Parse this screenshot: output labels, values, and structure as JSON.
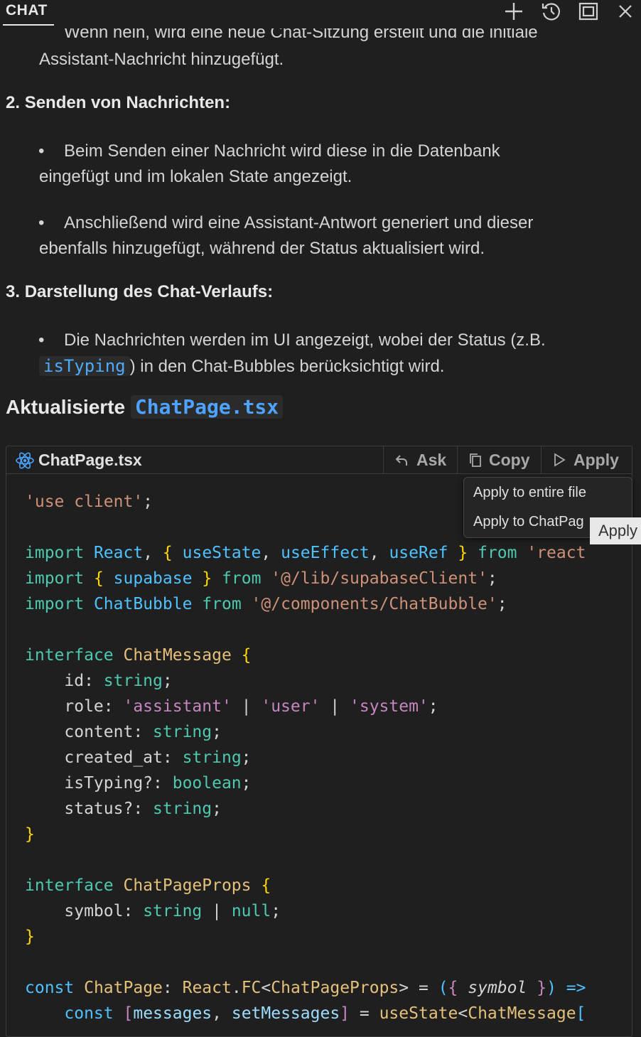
{
  "header": {
    "tab_label": "CHAT",
    "icons": [
      "plus-icon",
      "history-icon",
      "maximize-icon",
      "close-icon"
    ]
  },
  "message": {
    "cut_line": "Wenn nein, wird eine neue Chat-Sitzung erstellt und die initiale",
    "line0": "Assistant-Nachricht hinzugefügt.",
    "section2_num": "2.",
    "section2_title": "Senden von Nachrichten:",
    "s2_b1_l1": "Beim Senden einer Nachricht wird diese in die Datenbank",
    "s2_b1_l2": "eingefügt und im lokalen State angezeigt.",
    "s2_b2_l1": "Anschließend wird eine Assistant-Antwort generiert und dieser",
    "s2_b2_l2": "ebenfalls hinzugefügt, während der Status aktualisiert wird.",
    "section3_num": "3.",
    "section3_title": "Darstellung des Chat-Verlaufs:",
    "s3_b1_l1": "Die Nachrichten werden im UI angezeigt, wobei der Status (z.B.",
    "s3_b1_code": "isTyping",
    "s3_b1_l2": ") in den Chat-Bubbles berücksichtigt wird.",
    "h2_text": "Aktualisierte",
    "h2_code": "ChatPage.tsx"
  },
  "codeblock": {
    "filename": "ChatPage.tsx",
    "ask_label": "Ask",
    "copy_label": "Copy",
    "apply_label": "Apply",
    "code": {
      "l1": [
        "'use client'",
        ";"
      ],
      "l3": [
        "import",
        "React",
        "useState",
        "useEffect",
        "useRef",
        "from",
        "'react"
      ],
      "l4": [
        "import",
        "supabase",
        "from",
        "'@/lib/supabaseClient'",
        ";"
      ],
      "l5": [
        "import",
        "ChatBubble",
        "from",
        "'@/components/ChatBubble'",
        ";"
      ],
      "l7": [
        "interface",
        "ChatMessage"
      ],
      "l8": [
        "id",
        "string"
      ],
      "l9": [
        "role",
        "'assistant'",
        "'user'",
        "'system'"
      ],
      "l10": [
        "content",
        "string"
      ],
      "l11": [
        "created_at",
        "string"
      ],
      "l12": [
        "isTyping?",
        "boolean"
      ],
      "l13": [
        "status?",
        "string"
      ],
      "l16": [
        "interface",
        "ChatPageProps"
      ],
      "l17": [
        "symbol",
        "string",
        "null"
      ],
      "l20": [
        "const",
        "ChatPage",
        "React",
        "FC",
        "ChatPageProps",
        "symbol",
        "=>"
      ],
      "l21": [
        "const",
        "messages",
        "setMessages",
        "useState",
        "ChatMessage"
      ]
    }
  },
  "apply_menu": {
    "item1": "Apply to entire file",
    "item2": "Apply to ChatPag",
    "tooltip": "Apply"
  }
}
